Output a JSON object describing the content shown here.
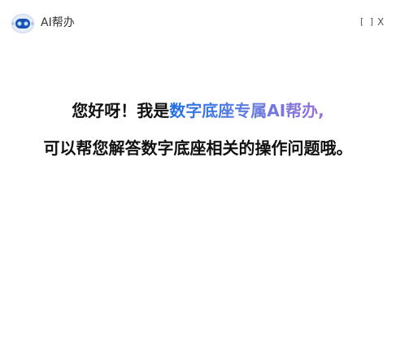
{
  "window": {
    "title": "AI帮办",
    "logo_icon": "robot-icon",
    "maximize_label": "[ ]",
    "close_label": "X"
  },
  "welcome": {
    "line1_prefix": "您好呀！我是",
    "line1_highlight": "数字底座专属AI帮办,",
    "line2": "可以帮您解答数字底座相关的操作问题哦。"
  },
  "colors": {
    "highlight_start": "#1f6fe8",
    "highlight_end": "#9b6fd8",
    "text": "#111111"
  }
}
